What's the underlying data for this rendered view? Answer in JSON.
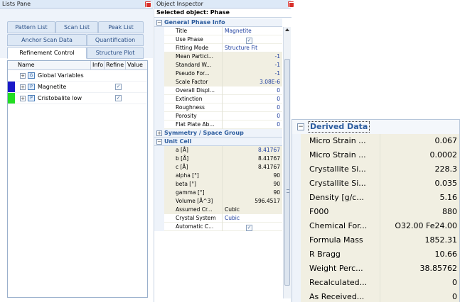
{
  "lists_pane": {
    "title": "Lists Pane",
    "tabs": [
      {
        "label": "Pattern List"
      },
      {
        "label": "Scan List"
      },
      {
        "label": "Peak List"
      },
      {
        "label": "Anchor Scan Data"
      },
      {
        "label": "Quantification"
      },
      {
        "label": "Refinement Control"
      },
      {
        "label": "Structure Plot"
      }
    ],
    "active_tab": "Refinement Control",
    "columns": [
      "Name",
      "Info",
      "Refine",
      "Value"
    ],
    "rows": [
      {
        "label": "Global Variables",
        "color": "",
        "refine": false
      },
      {
        "label": "Magnetite",
        "color": "#1919c8",
        "refine": true
      },
      {
        "label": "Cristobalite low",
        "color": "#22dd22",
        "refine": true
      }
    ]
  },
  "object_inspector": {
    "title": "Object Inspector",
    "selected": "Selected object: Phase",
    "general": {
      "header": "General Phase Info",
      "props": [
        {
          "name": "Title",
          "value": "Magnetite"
        },
        {
          "name": "Use Phase",
          "value": ""
        },
        {
          "name": "Fitting Mode",
          "value": "Structure Fit"
        },
        {
          "name": "Mean Particl...",
          "value": "-1"
        },
        {
          "name": "Standard W...",
          "value": "-1"
        },
        {
          "name": "Pseudo For...",
          "value": "-1"
        },
        {
          "name": "Scale Factor",
          "value": "3.08E-6"
        },
        {
          "name": "Overall Displ...",
          "value": "0"
        },
        {
          "name": "Extinction",
          "value": "0"
        },
        {
          "name": "Roughness",
          "value": "0"
        },
        {
          "name": "Porosity",
          "value": "0"
        },
        {
          "name": "Flat Plate Ab...",
          "value": "0"
        }
      ]
    },
    "symmetry": {
      "header": "Symmetry / Space Group"
    },
    "unit_cell": {
      "header": "Unit Cell",
      "props": [
        {
          "name": "a [Å]",
          "value": "8.41767"
        },
        {
          "name": "b [Å]",
          "value": "8.41767"
        },
        {
          "name": "c [Å]",
          "value": "8.41767"
        },
        {
          "name": "alpha [°]",
          "value": "90"
        },
        {
          "name": "beta [°]",
          "value": "90"
        },
        {
          "name": "gamma [°]",
          "value": "90"
        },
        {
          "name": "Volume [Å^3]",
          "value": "596.4517"
        },
        {
          "name": "Assumed Cr...",
          "value": "Cubic"
        },
        {
          "name": "Crystal System",
          "value": "Cubic"
        },
        {
          "name": "Automatic C...",
          "value": ""
        }
      ]
    }
  },
  "derived": {
    "header": "Derived Data",
    "rows": [
      {
        "name": "Micro Strain ...",
        "value": "0.067"
      },
      {
        "name": "Micro Strain ...",
        "value": "0.0002"
      },
      {
        "name": "Crystallite Si...",
        "value": "228.3"
      },
      {
        "name": "Crystallite Si...",
        "value": "0.035"
      },
      {
        "name": "Density [g/c...",
        "value": "5.16"
      },
      {
        "name": "F000",
        "value": "880"
      },
      {
        "name": "Chemical For...",
        "value": "O32.00 Fe24.00"
      },
      {
        "name": "Formula Mass",
        "value": "1852.31"
      },
      {
        "name": "R Bragg",
        "value": "10.66"
      },
      {
        "name": "Weight Perc...",
        "value": "38.85762"
      },
      {
        "name": "Recalculated...",
        "value": "0"
      },
      {
        "name": "As Received...",
        "value": "0"
      }
    ]
  }
}
